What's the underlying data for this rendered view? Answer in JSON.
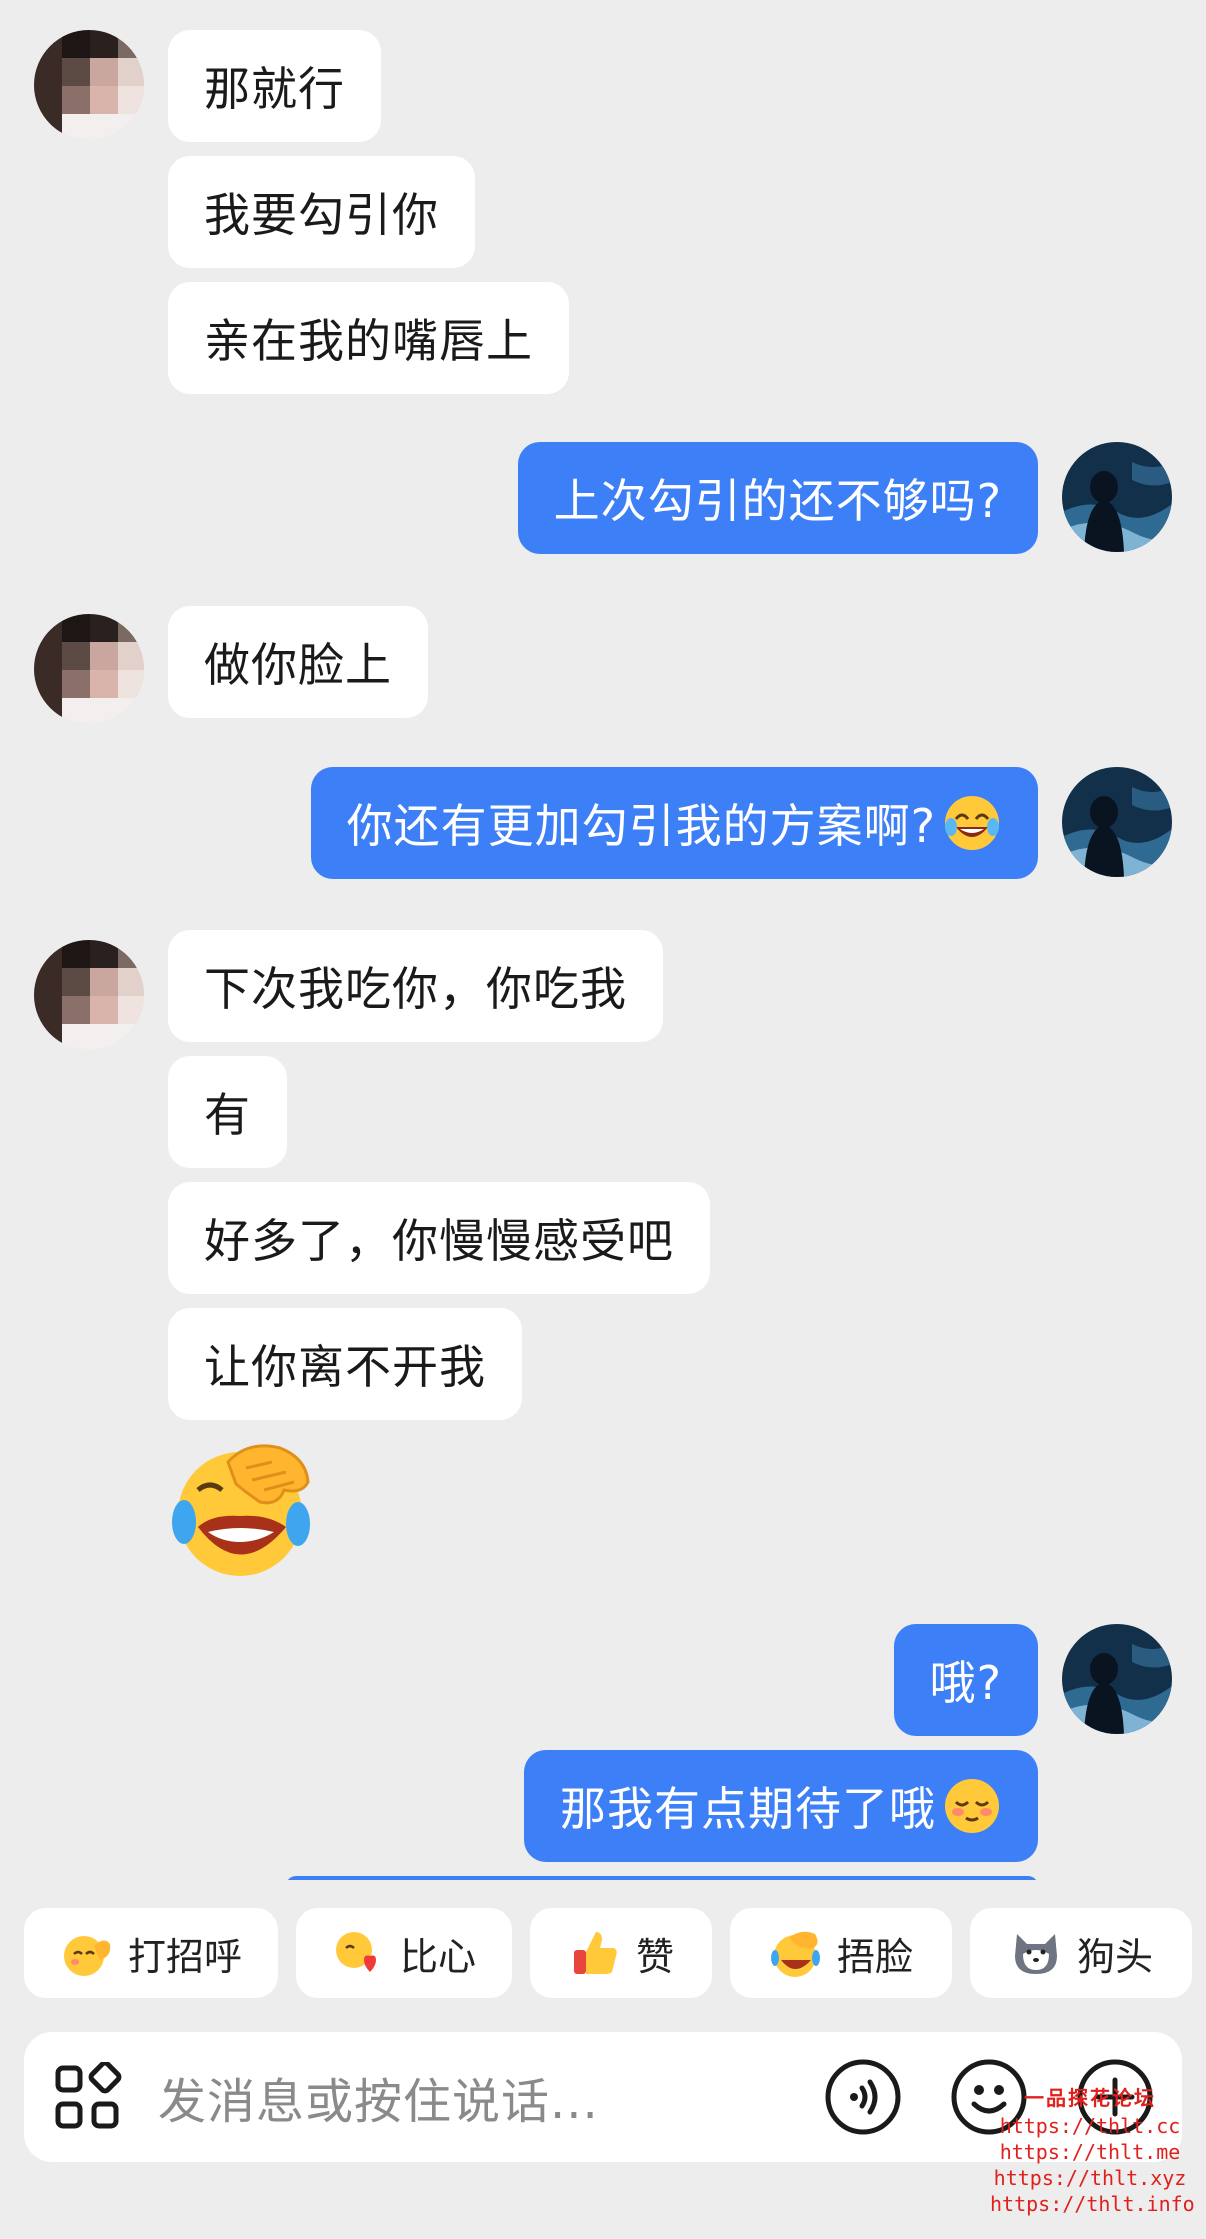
{
  "messages": {
    "m1": "那就行",
    "m2": "我要勾引你",
    "m3": "亲在我的嘴唇上",
    "m4": "上次勾引的还不够吗?",
    "m5": "做你脸上",
    "m6": "你还有更加勾引我的方案啊?",
    "m7": "下次我吃你，你吃我",
    "m8": "有",
    "m9": "好多了，你慢慢感受吧",
    "m10": "让你离不开我",
    "m11": "哦?",
    "m12": "那我有点期待了哦"
  },
  "quick_replies": {
    "q1": "打招呼",
    "q2": "比心",
    "q3": "赞",
    "q4": "捂脸",
    "q5": "狗头"
  },
  "composer": {
    "placeholder": "发消息或按住说话..."
  },
  "watermark": {
    "title": "一品探花论坛",
    "url1": "https://thlt.cc",
    "url2": "https://thlt.me",
    "url3": "https://thlt.xyz",
    "url4": "https://thlt.info"
  },
  "colors": {
    "background": "#ededed",
    "outgoing_bubble": "#3d7ff7",
    "incoming_bubble": "#ffffff",
    "watermark": "#e0201c"
  },
  "icons": [
    "apps-grid-icon",
    "voice-icon",
    "emoji-face-icon",
    "plus-icon",
    "laugh-cry-emoji",
    "facepalm-emoji",
    "wave-emoji",
    "heart-hands-emoji",
    "thumbs-up-emoji",
    "doge-emoji"
  ]
}
